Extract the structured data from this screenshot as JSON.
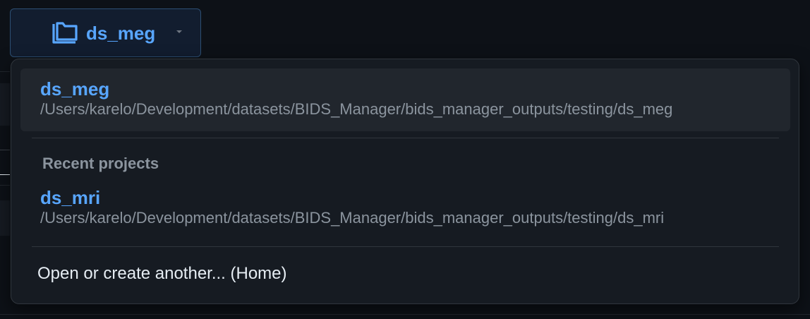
{
  "switcher": {
    "current_project": "ds_meg",
    "icon": "folder-icon",
    "caret_icon": "caret-down-icon"
  },
  "menu": {
    "current": {
      "name": "ds_meg",
      "path": "/Users/karelo/Development/datasets/BIDS_Manager/bids_manager_outputs/testing/ds_meg"
    },
    "recent_title": "Recent projects",
    "recent": [
      {
        "name": "ds_mri",
        "path": "/Users/karelo/Development/datasets/BIDS_Manager/bids_manager_outputs/testing/ds_mri"
      }
    ],
    "open_other_label": "Open or create another... (Home)"
  },
  "colors": {
    "accent": "#58a6ff",
    "background": "#0d1117",
    "menu_background": "#161b22",
    "muted_text": "#8b949e",
    "primary_text": "#e6edf3"
  }
}
